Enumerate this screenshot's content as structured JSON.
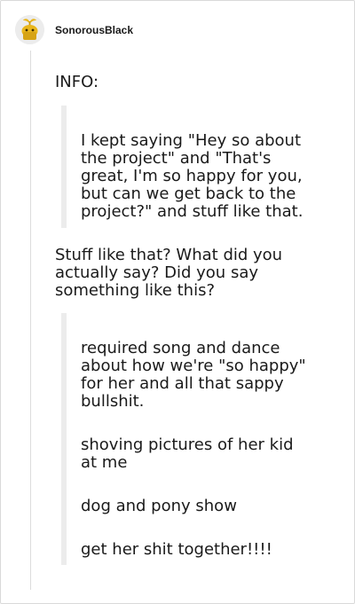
{
  "post": {
    "username": "SonorousBlack",
    "avatar_icon": "yellow-sprout-avatar-icon"
  },
  "body": {
    "info_heading": "INFO:",
    "quote1": [
      "I kept saying \"Hey so about",
      "the project\" and \"That's",
      "great, I'm so happy for you,",
      "but can we get back to the",
      "project?\" and stuff like that."
    ],
    "reply": [
      "Stuff like that? What did you",
      "actually say? Did you say",
      "something like this?"
    ],
    "quote2": {
      "p1": [
        "required song and dance",
        "about how we're \"so happy\"",
        "for her and all that sappy",
        "bullshit."
      ],
      "p2": [
        "shoving pictures of her kid",
        "at me"
      ],
      "p3": "dog and pony show",
      "p4": "get her shit together!!!!"
    }
  },
  "colors": {
    "quote_bar": "#ececec",
    "thread_line": "#dcdcdc",
    "avatar_yellow": "#e9b61c"
  }
}
